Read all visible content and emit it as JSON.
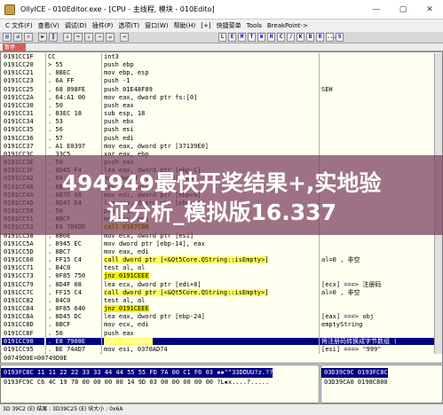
{
  "window": {
    "title": "OllyICE - 010Editor.exe - [CPU - 主线程, 模块 - 010Edito]",
    "min": "—",
    "max": "▢",
    "close": "✕"
  },
  "menu": [
    "C 文件(F)",
    "查看(V)",
    "调试(D)",
    "插件(P)",
    "选项(T)",
    "窗口(W)",
    "帮助(H)",
    "[+]",
    "快捷菜单",
    "Tools",
    "BreakPoint->"
  ],
  "toolbar": {
    "letters": [
      "L",
      "E",
      "M",
      "T",
      "W",
      "H",
      "C",
      "/",
      "K",
      "B",
      "R",
      "...",
      "S"
    ]
  },
  "state": {
    "paused": "暂停"
  },
  "disasm": [
    {
      "addr": "0191CC1F",
      "hex": "  CC",
      "asm": "int3"
    },
    {
      "addr": "0191CC20",
      "hex": ">  55",
      "asm": "push    ebp"
    },
    {
      "addr": "0191CC21",
      "hex": ". 8BEC",
      "asm": "mov     ebp, esp"
    },
    {
      "addr": "0191CC23",
      "hex": ". 6A FF",
      "asm": "push    -1"
    },
    {
      "addr": "0191CC25",
      "hex": ". 68 898FE",
      "asm": "push    01E48F89",
      "reg": "SEH"
    },
    {
      "addr": "0191CC2A",
      "hex": ". 64:A1 00",
      "asm": "mov     eax, dword ptr fs:[0]"
    },
    {
      "addr": "0191CC30",
      "hex": ". 50",
      "asm": "push    eax"
    },
    {
      "addr": "0191CC31",
      "hex": ". 83EC 18",
      "asm": "sub     esp, 18"
    },
    {
      "addr": "0191CC34",
      "hex": ". 53",
      "asm": "push    ebx"
    },
    {
      "addr": "0191CC35",
      "hex": ". 56",
      "asm": "push    esi"
    },
    {
      "addr": "0191CC36",
      "hex": ". 57",
      "asm": "push    edi"
    },
    {
      "addr": "0191CC37",
      "hex": ". A1 E0397",
      "asm": "mov     eax, dword ptr [37139E0]"
    },
    {
      "addr": "0191CC3C",
      "hex": ". 33C5",
      "asm": "xor     eax, ebp"
    },
    {
      "addr": "0191CC3E",
      "hex": ". 50",
      "asm": "push    eax"
    },
    {
      "addr": "0191CC3F",
      "hex": ". 8D45 F4",
      "asm": "lea     eax, dword ptr [ebp-C]"
    },
    {
      "addr": "0191CC42",
      "hex": ". 64:A3 00",
      "asm": "mov     dword ptr fs:[0], eax"
    },
    {
      "addr": "0191CC48",
      "hex": ". 8BF1",
      "asm": "mov     esi, ecx"
    },
    {
      "addr": "0191CC4A",
      "hex": ". 8B7D 08",
      "asm": "mov     edi, dword ptr [ebp+8]"
    },
    {
      "addr": "0191CC4D",
      "hex": ". 8D45 E4",
      "asm": "lea     eax, dword ptr [ebp-1C]"
    },
    {
      "addr": "0191CC50",
      "hex": ". 50",
      "asm": "push    eax"
    },
    {
      "addr": "0191CC51",
      "hex": ". 8BCF",
      "asm": "mov     ecx, edi"
    },
    {
      "addr": "0191CC53",
      "hex": ". E8 786DD",
      "asm": "call    0167CB0"
    },
    {
      "addr": "0191CC58",
      "hex": ". 8B0E",
      "asm": "mov     ecx, dword ptr [esi]"
    },
    {
      "addr": "0191CC5A",
      "hex": ". 8945 EC",
      "asm": "mov     dword ptr [ebp-14], eax"
    },
    {
      "addr": "0191CC5D",
      "hex": ". 8BC7",
      "asm": "mov     eax, edi"
    },
    {
      "addr": "0191CC60",
      "hex": ". FF15 C4",
      "asm": "call    dword ptr [<&Qt5Core.QString::isEmpty>]",
      "reg": "al=0 , 非空"
    },
    {
      "addr": "0191CC71",
      "hex": ". 84C0",
      "asm": "test    al, al"
    },
    {
      "addr": "0191CC73",
      "hex": ". 0F85 750",
      "asm": "jnz     0191CEEE"
    },
    {
      "addr": "0191CC79",
      "hex": ". 8D4F 08",
      "asm": "lea     ecx, dword ptr [edi+8]",
      "reg": "[ecx] ===> 注册码"
    },
    {
      "addr": "0191CC7C",
      "hex": ". FF15 C4",
      "asm": "call    dword ptr [<&Qt5Core.QString::isEmpty>]",
      "reg": "al=0 , 非空"
    },
    {
      "addr": "0191CC82",
      "hex": ". 84C0",
      "asm": "test    al, al"
    },
    {
      "addr": "0191CC84",
      "hex": ". 0F85 640",
      "asm": "jnz     0191CEEE"
    },
    {
      "addr": "0191CC8A",
      "hex": ". 8D45 DC",
      "asm": "lea     eax, dword ptr [ebp-24]",
      "reg": "[eax] ===> obj"
    },
    {
      "addr": "0191CC8D",
      "hex": ". 8BCF",
      "asm": "mov     ecx, edi",
      "reg": "emptyString"
    },
    {
      "addr": "0191CC8F",
      "hex": ". 50",
      "asm": "push    eax"
    },
    {
      "addr": "0191CC90",
      "hex": ". E8 7908E",
      "asm": "call    00749D0E",
      "reg": "将注册码转换成字节数组 ("
    },
    {
      "addr": "0191CC95",
      "hex": ". BE 74AD7",
      "asm": "mov     esi, 0370AD74",
      "reg": "[esi] ===> \"999\""
    }
  ],
  "info": "00749D0E=00749D0E",
  "dump": [
    {
      "addr": "0193FC8C",
      "bytes": "11 11 22 22 33 33 44 44 55 55 FD 7A 00 C1 F6 03",
      "ascii": "▪▪\"\"33DDUU?z.??"
    },
    {
      "addr": "0193FC9C",
      "bytes": "C6 4C 19 78 00 00 00 00 14 9D 03 00 00 00 00 00",
      "ascii": "?L▪x....?....."
    }
  ],
  "stack": [
    {
      "addr": "03D39C9C",
      "val": "0193FC8C"
    },
    {
      "addr": "03D39CA0",
      "val": "0198C800"
    }
  ],
  "statusbar": "3D 39C2 (E) 结果 : 3D39C25 (E)  块大小 : 0x6A",
  "overlay": {
    "line1": "494949最快开奖结果+,实地验",
    "line2": "证分析_模拟版16.337"
  },
  "colors": {
    "selection": "#000080",
    "jump": "#f0f000",
    "overlay": "#783c5a"
  }
}
